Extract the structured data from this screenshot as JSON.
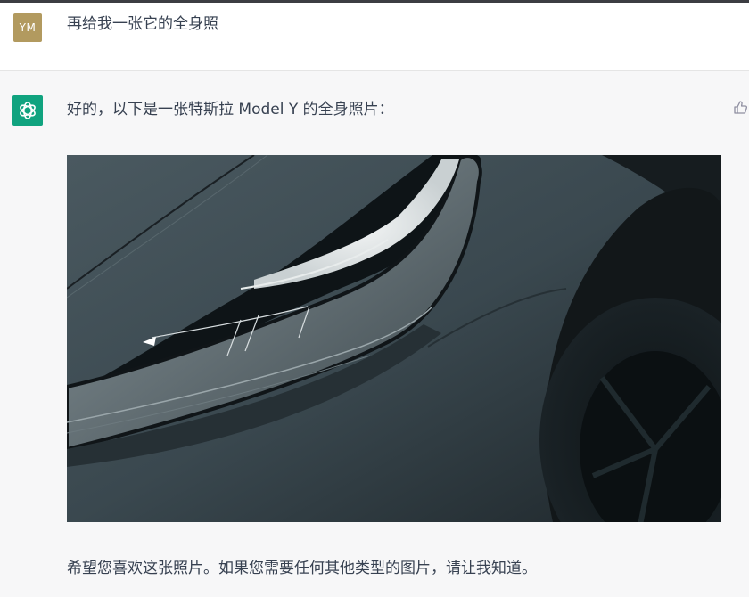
{
  "user": {
    "avatar_initials": "YM",
    "message": "再给我一张它的全身照"
  },
  "assistant": {
    "intro": "好的，以下是一张特斯拉 Model Y 的全身照片：",
    "outro": "希望您喜欢这张照片。如果您需要任何其他类型的图片，请让我知道。",
    "image_subject": "Tesla Model Y headlight close-up",
    "feedback_icon": "thumbs-up-icon"
  },
  "colors": {
    "user_avatar_bg": "#b29a5f",
    "assistant_avatar_bg": "#10a37f",
    "assistant_row_bg": "#f7f7f8"
  }
}
